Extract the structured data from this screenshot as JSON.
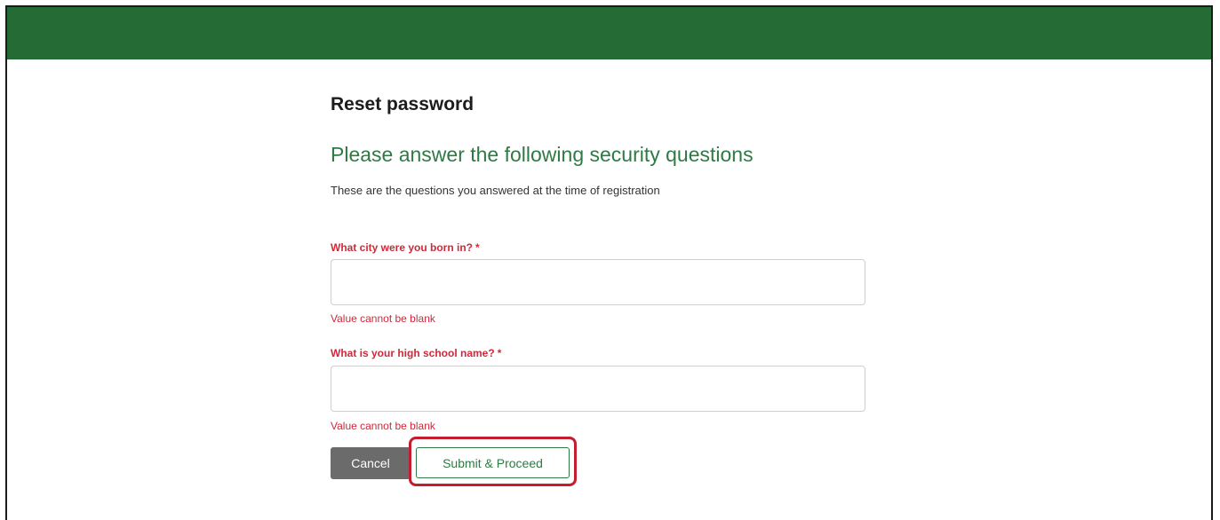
{
  "colors": {
    "header_bar": "#246b35",
    "accent_green": "#2f7a44",
    "error_red": "#d0293a",
    "cancel_bg": "#6b6b6b",
    "highlight_red": "#c41e2e"
  },
  "page": {
    "title": "Reset password",
    "subtitle": "Please answer the following security questions",
    "description": "These are the questions you answered at the time of registration"
  },
  "questions": [
    {
      "label": "What city were you born in?",
      "required_mark": "*",
      "value": "",
      "error": "Value cannot be blank"
    },
    {
      "label": "What is your high school name?",
      "required_mark": "*",
      "value": "",
      "error": "Value cannot be blank"
    }
  ],
  "actions": {
    "cancel_label": "Cancel",
    "submit_label": "Submit & Proceed"
  }
}
